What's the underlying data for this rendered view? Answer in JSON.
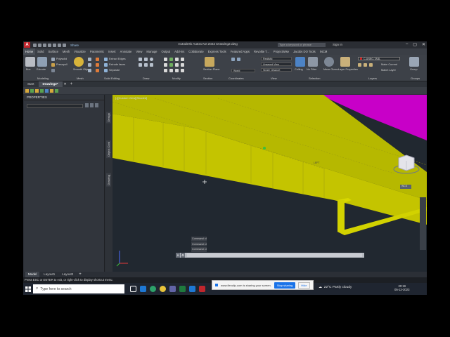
{
  "app": {
    "title": "Autodesk AutoCAD 2022   Drawing2.dwg",
    "share_label": "Share",
    "search_placeholder": "Type a keyword or phrase",
    "signin_label": "Sign In"
  },
  "menu_tabs": [
    "Home",
    "Solid",
    "Surface",
    "Mesh",
    "Visualize",
    "Parametric",
    "Insert",
    "Annotate",
    "View",
    "Manage",
    "Output",
    "Add-ins",
    "Collaborate",
    "Express Tools",
    "Featured Apps",
    "Revolite T...",
    "ProjectWise",
    "Jacobs DO Tools",
    "INCM"
  ],
  "ribbon": {
    "tools": {
      "box": "Box",
      "extrude": "Extrude",
      "polysolid": "Polysolid",
      "presspull": "Presspull",
      "smooth_object": "Smooth Object",
      "extract_edges": "Extract Edges",
      "extrude_faces": "Extrude faces",
      "separate": "Separate",
      "section_plane": "Section Plane",
      "world": "World",
      "culling": "Culling",
      "no_filter": "No Filter",
      "move_gizmo": "Move Gizmo",
      "layer_properties": "Layer Properties",
      "make_current": "Make Current",
      "match_layer": "Match Layer",
      "group": "Group"
    },
    "dropdowns": {
      "visual_style": "Realistic",
      "view": "Unsaved View",
      "viewport": "Single viewport",
      "layer": "C-ANNO-TABL"
    },
    "panel_labels": [
      "Modeling",
      "Mesh",
      "Solid Editing",
      "Draw",
      "Modify",
      "Section",
      "Coordinates",
      "View",
      "Selection",
      "Layers",
      "Groups"
    ]
  },
  "file_tabs": [
    "Start",
    "Drawing2*"
  ],
  "properties_title": "PROPERTIES",
  "side_labels": [
    "Design",
    "Object Cont",
    "Drawing"
  ],
  "viewport": {
    "label": "[-][Custom View][Shaded]",
    "cmd_history": [
      "Command: d",
      "Command: d",
      "Command: d"
    ],
    "cube_label": "LEFT",
    "wcs_label": "WCS"
  },
  "layout_tabs": [
    "Model",
    "Layout1",
    "Layout2"
  ],
  "status_text": "Press ESC or ENTER to exit, or right-click to display shortcut menu.",
  "taskbar": {
    "search_placeholder": "Type here to search",
    "share_notice": "www.flexclip.com is sharing your screen.",
    "stop_label": "Stop sharing",
    "hide_label": "Hide",
    "weather": "22°C  Partly cloudy",
    "time": "20:19",
    "date": "05-12-2023"
  },
  "colors": {
    "solid_face": "#c4c400",
    "solid_top": "#b6b800",
    "magenta": "#c800c8",
    "viewport_bg": "#212830",
    "accent": "#1a73e8"
  }
}
